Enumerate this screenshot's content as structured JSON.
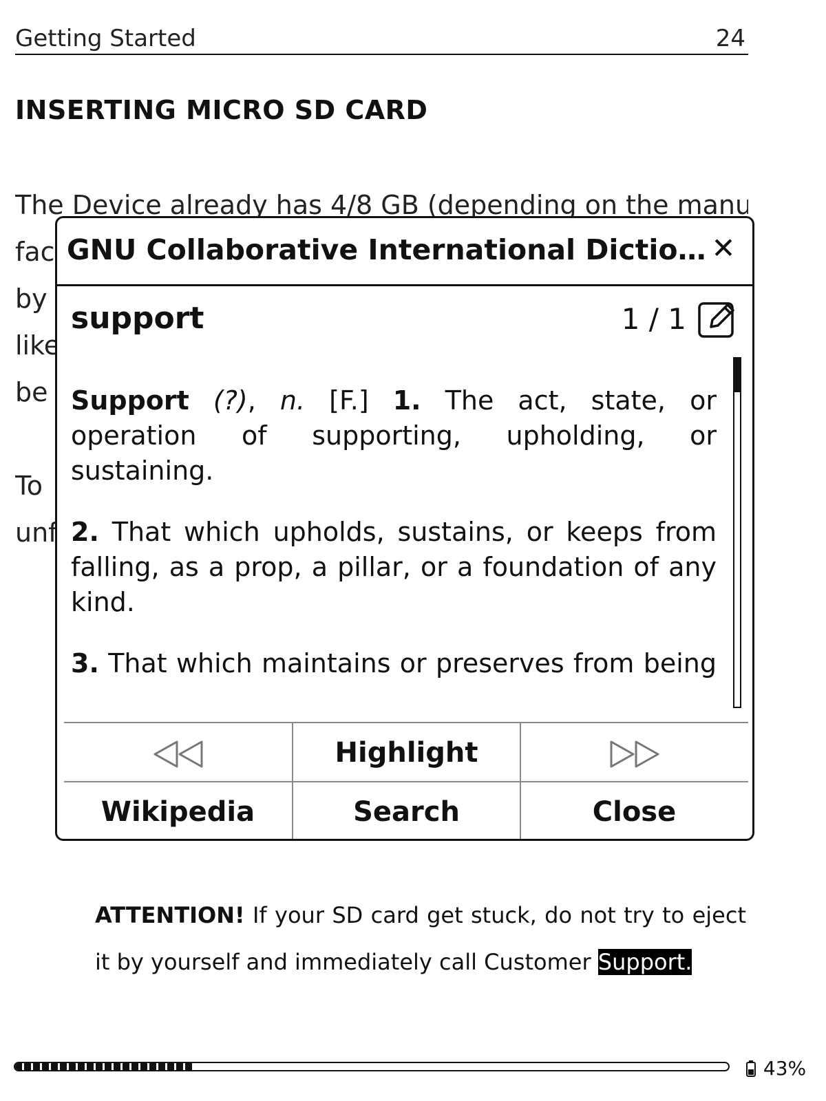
{
  "header": {
    "chapter": "Getting Started",
    "page_number": "24"
  },
  "section_heading": "INSERTING MICRO SD CARD",
  "background_lines": [
    "The Device already has 4/8 GB (depending on the manu-",
    "fac",
    "by",
    "like",
    "be",
    "To",
    "unf"
  ],
  "dictionary": {
    "title": "GNU Collaborative International Dictiona...",
    "word": "support",
    "result_count": "1 / 1",
    "definition": {
      "headword": "Support",
      "pronunciation": "(?)",
      "pos": "n.",
      "etymology": "[F.]",
      "senses": [
        {
          "num": "1.",
          "text": "The act, state, or operation of supporting, upholding, or sustaining."
        },
        {
          "num": "2.",
          "text": "That which upholds, sustains, or keeps from falling, as a prop, a pillar, or a foundation of any kind."
        },
        {
          "num": "3.",
          "text": "That which maintains or preserves from being overcome, falling, yielding, sinking, giving way, or"
        }
      ]
    },
    "scroll_position_fraction": 0.1,
    "buttons": {
      "prev_icon": "prev-double-triangle-icon",
      "highlight": "Highlight",
      "next_icon": "next-double-triangle-icon",
      "wikipedia": "Wikipedia",
      "search": "Search",
      "close": "Close"
    }
  },
  "attention": {
    "label": "ATTENTION!",
    "text": "If your SD card get stuck, do not try to eject it by yourself and immediately call Customer",
    "highlighted_word": "Support."
  },
  "footer": {
    "reading_progress_fraction": 0.25,
    "battery_percent": "43%"
  }
}
